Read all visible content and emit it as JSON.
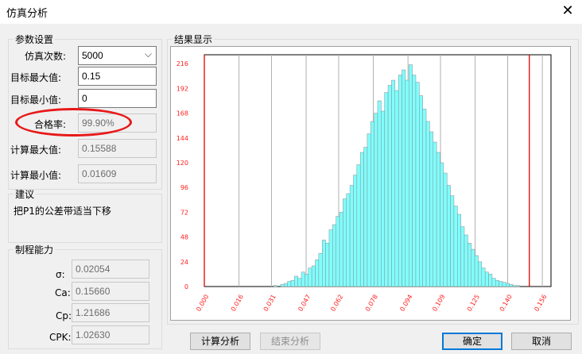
{
  "window": {
    "title": "仿真分析",
    "close_glyph": "✕"
  },
  "params": {
    "legend": "参数设置",
    "sim_count_label": "仿真次数:",
    "sim_count_value": "5000",
    "target_max_label": "目标最大值:",
    "target_max_value": "0.15",
    "target_min_label": "目标最小值:",
    "target_min_value": "0",
    "pass_rate_label": "合格率:",
    "pass_rate_value": "99.90%",
    "calc_max_label": "计算最大值:",
    "calc_max_value": "0.15588",
    "calc_min_label": "计算最小值:",
    "calc_min_value": "0.01609"
  },
  "suggestion": {
    "legend": "建议",
    "text": "把P1的公差带适当下移"
  },
  "capability": {
    "legend": "制程能力",
    "sigma_label": "σ:",
    "sigma_value": "0.02054",
    "ca_label": "Ca:",
    "ca_value": "0.15660",
    "cp_label": "Cp:",
    "cp_value": "1.21686",
    "cpk_label": "CPK:",
    "cpk_value": "1.02630"
  },
  "result": {
    "legend": "结果显示"
  },
  "buttons": {
    "calc": "计算分析",
    "end": "结束分析",
    "ok": "确定",
    "cancel": "取消"
  },
  "colors": {
    "bar": "#80ffff",
    "limit_line": "#e00000",
    "tick_text": "#ff2020",
    "highlight_oval": "#e81818"
  },
  "chart_data": {
    "type": "bar",
    "title": "",
    "xlabel": "",
    "ylabel": "",
    "xlim": [
      0.0,
      0.16
    ],
    "ylim": [
      0,
      216
    ],
    "x_ticks": [
      "0.000",
      "0.016",
      "0.031",
      "0.047",
      "0.062",
      "0.078",
      "0.094",
      "0.109",
      "0.125",
      "0.140",
      "0.156"
    ],
    "y_ticks": [
      "0",
      "24",
      "48",
      "72",
      "96",
      "120",
      "144",
      "168",
      "192",
      "216"
    ],
    "limits": {
      "lower": 0.0,
      "upper": 0.15
    },
    "bin_width": 0.0016,
    "bin_start": 0.0,
    "counts": [
      0,
      0,
      0,
      0,
      0,
      0,
      0,
      0,
      0,
      0,
      0,
      0,
      0,
      0,
      0,
      0,
      0,
      0,
      0,
      0,
      1,
      0,
      2,
      3,
      5,
      6,
      10,
      8,
      14,
      12,
      18,
      20,
      26,
      32,
      45,
      42,
      55,
      60,
      68,
      72,
      85,
      90,
      98,
      108,
      118,
      130,
      135,
      148,
      160,
      168,
      180,
      170,
      188,
      195,
      200,
      190,
      205,
      210,
      200,
      215,
      205,
      198,
      185,
      172,
      160,
      150,
      140,
      130,
      120,
      110,
      98,
      88,
      78,
      70,
      58,
      50,
      42,
      36,
      30,
      24,
      18,
      14,
      12,
      8,
      6,
      5,
      4,
      3,
      2,
      1,
      1,
      0,
      0,
      0,
      0,
      0,
      0,
      0,
      0,
      0
    ],
    "grid": true,
    "legend": "none"
  }
}
